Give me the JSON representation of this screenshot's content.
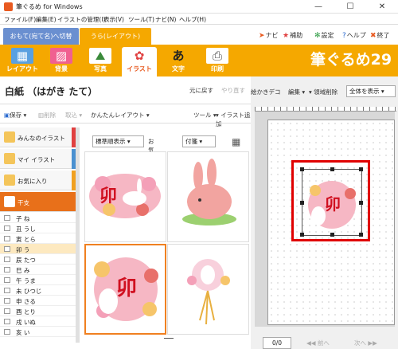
{
  "window": {
    "title": "筆ぐるめ for Windows",
    "controls": [
      "—",
      "☐",
      "✕"
    ]
  },
  "menu": [
    "ファイル(F)",
    "編集(E)",
    "イラストの管理(I)",
    "表示(V)",
    "ツール(T)",
    "ナビ(N)",
    "ヘルプ(H)"
  ],
  "tabs": {
    "front": "おもて(宛て名)へ切替",
    "back": "うら(レイアウト)"
  },
  "header_buttons": [
    {
      "icon": "navi-icon",
      "label": "ナビ"
    },
    {
      "icon": "star-icon",
      "label": "補助"
    },
    {
      "icon": "gear-icon",
      "label": "設定"
    },
    {
      "icon": "help-icon",
      "label": "ヘルプ"
    },
    {
      "icon": "exit-icon",
      "label": "終了"
    }
  ],
  "tools": [
    {
      "label": "レイアウト",
      "glyph": "▦"
    },
    {
      "label": "背景",
      "glyph": "▨"
    },
    {
      "label": "写真",
      "glyph": "⛰"
    },
    {
      "label": "イラスト",
      "glyph": "✿"
    },
    {
      "label": "文字",
      "glyph": "あ"
    },
    {
      "label": "印刷",
      "glyph": "⎙"
    }
  ],
  "logo": "筆ぐるめ29",
  "card": {
    "title": "白紙 （はがき たて）",
    "undo": "元に戻す",
    "redo": "やり直す"
  },
  "commands": {
    "save": "保存",
    "delete": "削除",
    "import": "取込",
    "simple_layout": "かんたんレイアウト",
    "tool": "ツール",
    "add_illust": "イラスト追加"
  },
  "right_toolbar": {
    "deco": "絵かきデコ",
    "edit": "編集",
    "area_delete": "領域削除",
    "view_select": "全体を表示"
  },
  "categories": [
    {
      "name": "みんなのイラスト",
      "stripe": "#e04040"
    },
    {
      "name": "マイ イラスト",
      "stripe": "#4a90d0"
    },
    {
      "name": "お気に入り",
      "stripe": "#f0a020"
    },
    {
      "name": "干支",
      "stripe": "#e8701a"
    }
  ],
  "zodiac": [
    "子 ね",
    "丑 うし",
    "寅 とら",
    "卯 う",
    "辰 たつ",
    "巳 み",
    "午 うま",
    "未 ひつじ",
    "申 さる",
    "酉 とり",
    "戌 いぬ",
    "亥 い"
  ],
  "filters": {
    "sort": "標準順表示",
    "fav": "お気に入り",
    "tag": "付箋"
  },
  "thumbnail_char": "卯",
  "pager": {
    "page": "0/0",
    "prev": "前へ",
    "next": "次へ"
  },
  "colors": {
    "accent": "#f5a800",
    "front_tab": "#6a8fd0",
    "selected": "#e8701a",
    "highlight_box": "#e00000"
  }
}
